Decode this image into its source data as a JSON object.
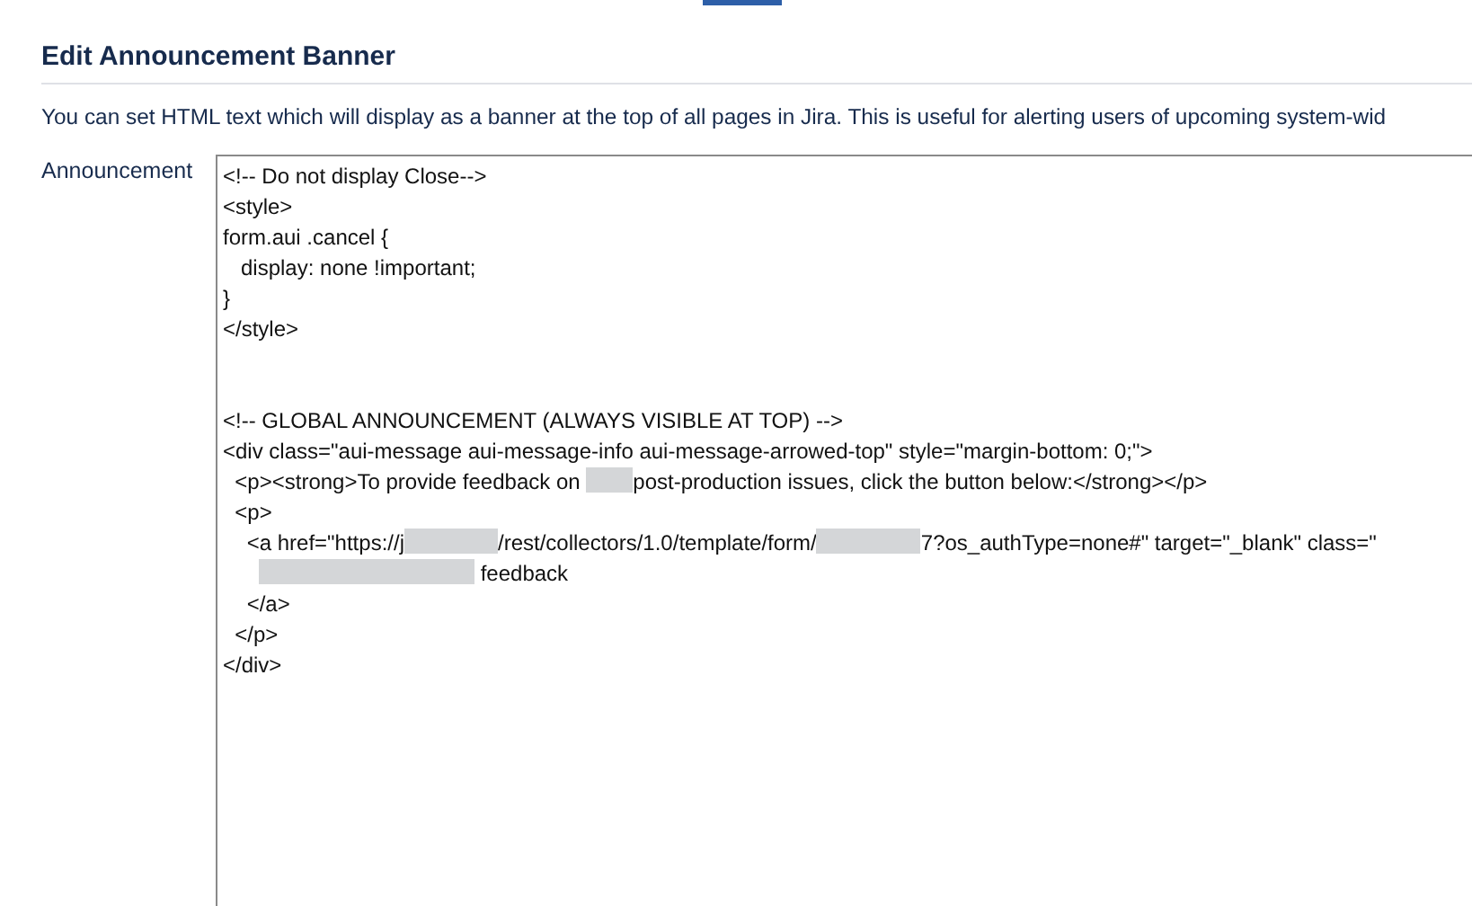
{
  "top_tab_indicator": {
    "selected": true
  },
  "title": "Edit Announcement Banner",
  "description": "You can set HTML text which will display as a banner at the top of all pages in Jira. This is useful for alerting users of upcoming system-wid",
  "announcement_field": {
    "label": "Announcement",
    "lines": [
      {
        "kind": "code",
        "parts": [
          {
            "kind": "text",
            "text": "<!-- Do not display Close-->"
          }
        ]
      },
      {
        "kind": "code",
        "parts": [
          {
            "kind": "text",
            "text": "<style>"
          }
        ]
      },
      {
        "kind": "code",
        "parts": [
          {
            "kind": "text",
            "text": "form.aui .cancel {"
          }
        ]
      },
      {
        "kind": "code",
        "parts": [
          {
            "kind": "text",
            "text": "   display: none !important;"
          }
        ]
      },
      {
        "kind": "code",
        "parts": [
          {
            "kind": "text",
            "text": "}"
          }
        ]
      },
      {
        "kind": "code",
        "parts": [
          {
            "kind": "text",
            "text": "</style>"
          }
        ]
      },
      {
        "kind": "blank"
      },
      {
        "kind": "blank"
      },
      {
        "kind": "code",
        "parts": [
          {
            "kind": "text",
            "text": "<!-- GLOBAL ANNOUNCEMENT (ALWAYS VISIBLE AT TOP) -->"
          }
        ]
      },
      {
        "kind": "code",
        "parts": [
          {
            "kind": "text",
            "text": "<div class=\"aui-message aui-message-info aui-message-arrowed-top\" style=\"margin-bottom: 0;\">"
          }
        ]
      },
      {
        "kind": "code",
        "parts": [
          {
            "kind": "text",
            "text": "  <p><strong>To provide feedback on "
          },
          {
            "kind": "redacted"
          },
          {
            "kind": "text",
            "text": "post-production issues, click the button below:</strong></p>"
          }
        ]
      },
      {
        "kind": "code",
        "parts": [
          {
            "kind": "text",
            "text": "  <p>"
          }
        ]
      },
      {
        "kind": "code",
        "parts": [
          {
            "kind": "text",
            "text": "    <a href=\"https://j"
          },
          {
            "kind": "redacted"
          },
          {
            "kind": "text",
            "text": "/rest/collectors/1.0/template/form/"
          },
          {
            "kind": "redacted"
          },
          {
            "kind": "text",
            "text": "7?os_authType=none#\" target=\"_blank\" class=\""
          }
        ]
      },
      {
        "kind": "code",
        "parts": [
          {
            "kind": "indent"
          },
          {
            "kind": "redacted"
          },
          {
            "kind": "text",
            "text": " feedback"
          }
        ]
      },
      {
        "kind": "code",
        "parts": [
          {
            "kind": "text",
            "text": "    </a>"
          }
        ]
      },
      {
        "kind": "code",
        "parts": [
          {
            "kind": "text",
            "text": "  </p>"
          }
        ]
      },
      {
        "kind": "code",
        "parts": [
          {
            "kind": "text",
            "text": "</div>"
          }
        ]
      }
    ]
  }
}
